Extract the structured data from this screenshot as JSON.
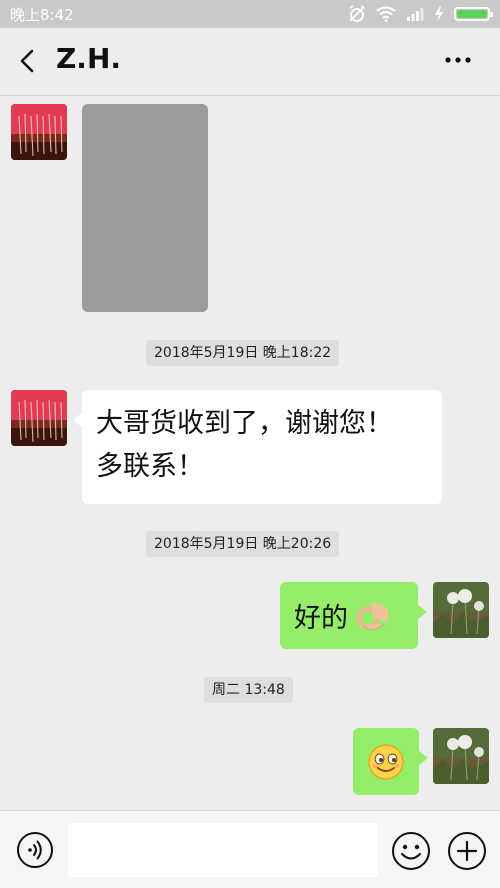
{
  "status_bar": {
    "time": "晚上8:42",
    "icons": [
      "alarm-off-icon",
      "wifi-icon",
      "signal-icon",
      "charging-icon",
      "battery-icon"
    ],
    "battery_level": 1.0
  },
  "header": {
    "title": "Z.H.",
    "back_icon": "chevron-left-icon",
    "more_icon": "more-dots-icon"
  },
  "messages": [
    {
      "side": "left",
      "type": "image",
      "hidden": true
    },
    {
      "type": "timestamp",
      "text": "2018年5月19日 晚上18:22"
    },
    {
      "side": "left",
      "type": "text",
      "lines": [
        "大哥货收到了，谢谢您！",
        "多联系！"
      ]
    },
    {
      "type": "timestamp",
      "text": "2018年5月19日 晚上20:26"
    },
    {
      "side": "right",
      "type": "text",
      "text": "好的",
      "emoji": "ok-hand-emoji"
    },
    {
      "type": "timestamp",
      "text": "周二 13:48"
    },
    {
      "side": "right",
      "type": "emoji",
      "emoji": "smiling-face-emoji"
    }
  ],
  "input_bar": {
    "voice_icon": "voice-icon",
    "input_value": "",
    "emoji_icon": "emoji-icon",
    "plus_icon": "plus-icon"
  },
  "colors": {
    "background": "#ededed",
    "status_bar": "#c9c9c9",
    "sent_bubble": "#95ec69",
    "received_bubble": "#ffffff",
    "timestamp_bg": "#dedede",
    "battery": "#5bd35b"
  }
}
